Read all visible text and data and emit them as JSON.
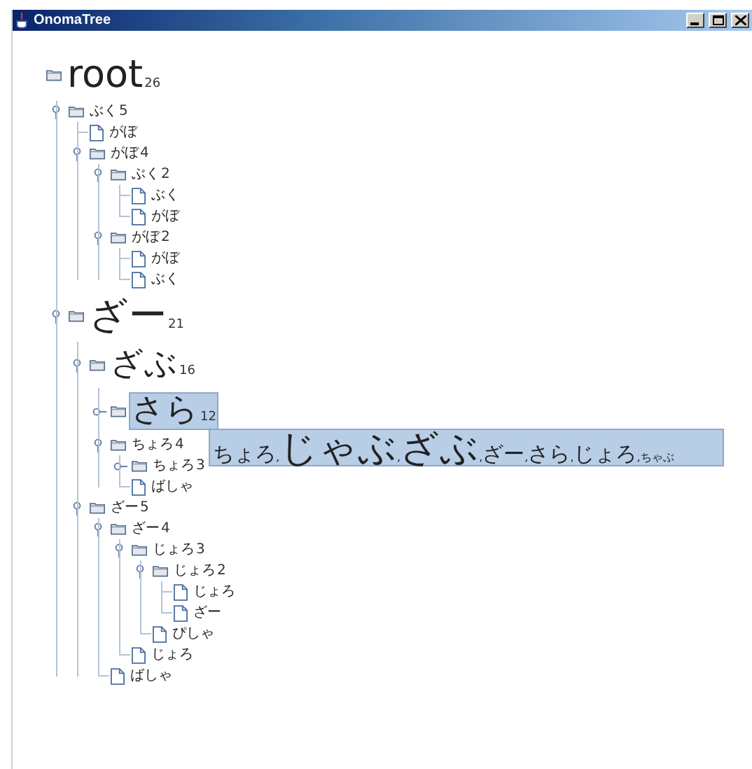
{
  "window": {
    "title": "OnomaTree"
  },
  "tree": {
    "label": "root",
    "count": "26",
    "kind": "large",
    "selected": false,
    "children": [
      {
        "label": "ぶく",
        "count": "5",
        "kind": "small",
        "selected": false,
        "expanded": true,
        "children": [
          {
            "label": "がぼ",
            "kind": "small",
            "selected": false
          },
          {
            "label": "がぼ",
            "count": "4",
            "kind": "small",
            "selected": false,
            "expanded": true,
            "children": [
              {
                "label": "ぶく",
                "count": "2",
                "kind": "small",
                "selected": false,
                "expanded": true,
                "children": [
                  {
                    "label": "ぶく",
                    "kind": "small",
                    "selected": false
                  },
                  {
                    "label": "がぼ",
                    "kind": "small",
                    "selected": false
                  }
                ]
              },
              {
                "label": "がぼ",
                "count": "2",
                "kind": "small",
                "selected": false,
                "expanded": true,
                "children": [
                  {
                    "label": "がぼ",
                    "kind": "small",
                    "selected": false
                  },
                  {
                    "label": "ぶく",
                    "kind": "small",
                    "selected": false
                  }
                ]
              }
            ]
          }
        ]
      },
      {
        "label": "ざー",
        "count": "21",
        "kind": "large",
        "selected": false,
        "expanded": true,
        "children": [
          {
            "label": "ざぶ",
            "count": "16",
            "kind": "medium",
            "selected": false,
            "expanded": true,
            "children": [
              {
                "label": "さら",
                "count": "12",
                "kind": "medium",
                "selected": true,
                "expanded": false
              },
              {
                "label": "ちょろ",
                "count": "4",
                "kind": "small",
                "selected": false,
                "expanded": true,
                "children": [
                  {
                    "label": "ちょろ",
                    "count": "3",
                    "kind": "small",
                    "selected": false,
                    "expanded": false
                  },
                  {
                    "label": "ばしゃ",
                    "kind": "small",
                    "selected": false
                  }
                ]
              }
            ]
          },
          {
            "label": "ざー",
            "count": "5",
            "kind": "small",
            "selected": false,
            "expanded": true,
            "children": [
              {
                "label": "ざー",
                "count": "4",
                "kind": "small",
                "selected": false,
                "expanded": true,
                "children": [
                  {
                    "label": "じょろ",
                    "count": "3",
                    "kind": "small",
                    "selected": false,
                    "expanded": true,
                    "children": [
                      {
                        "label": "じょろ",
                        "count": "2",
                        "kind": "small",
                        "selected": false,
                        "expanded": true,
                        "children": [
                          {
                            "label": "じょろ",
                            "kind": "small",
                            "selected": false
                          },
                          {
                            "label": "ざー",
                            "kind": "small",
                            "selected": false
                          }
                        ]
                      },
                      {
                        "label": "ぴしゃ",
                        "kind": "small",
                        "selected": false
                      }
                    ]
                  },
                  {
                    "label": "じょろ",
                    "kind": "small",
                    "selected": false
                  }
                ]
              },
              {
                "label": "ばしゃ",
                "kind": "small",
                "selected": false
              }
            ]
          }
        ]
      }
    ]
  },
  "tooltip": {
    "items": [
      {
        "text": "ちょろ",
        "sep": ",",
        "kind": "small"
      },
      {
        "text": "じゃぶ",
        "sep": ",",
        "kind": "large"
      },
      {
        "text": "ざぶ",
        "sep": ",",
        "kind": "large"
      },
      {
        "text": "ざー",
        "sep": ",",
        "kind": "small"
      },
      {
        "text": "さら",
        "sep": ",",
        "kind": "small"
      },
      {
        "text": "じょろ",
        "sep": ",",
        "kind": "small"
      },
      {
        "text": "ちゃぶ",
        "kind": "tiny"
      }
    ]
  }
}
